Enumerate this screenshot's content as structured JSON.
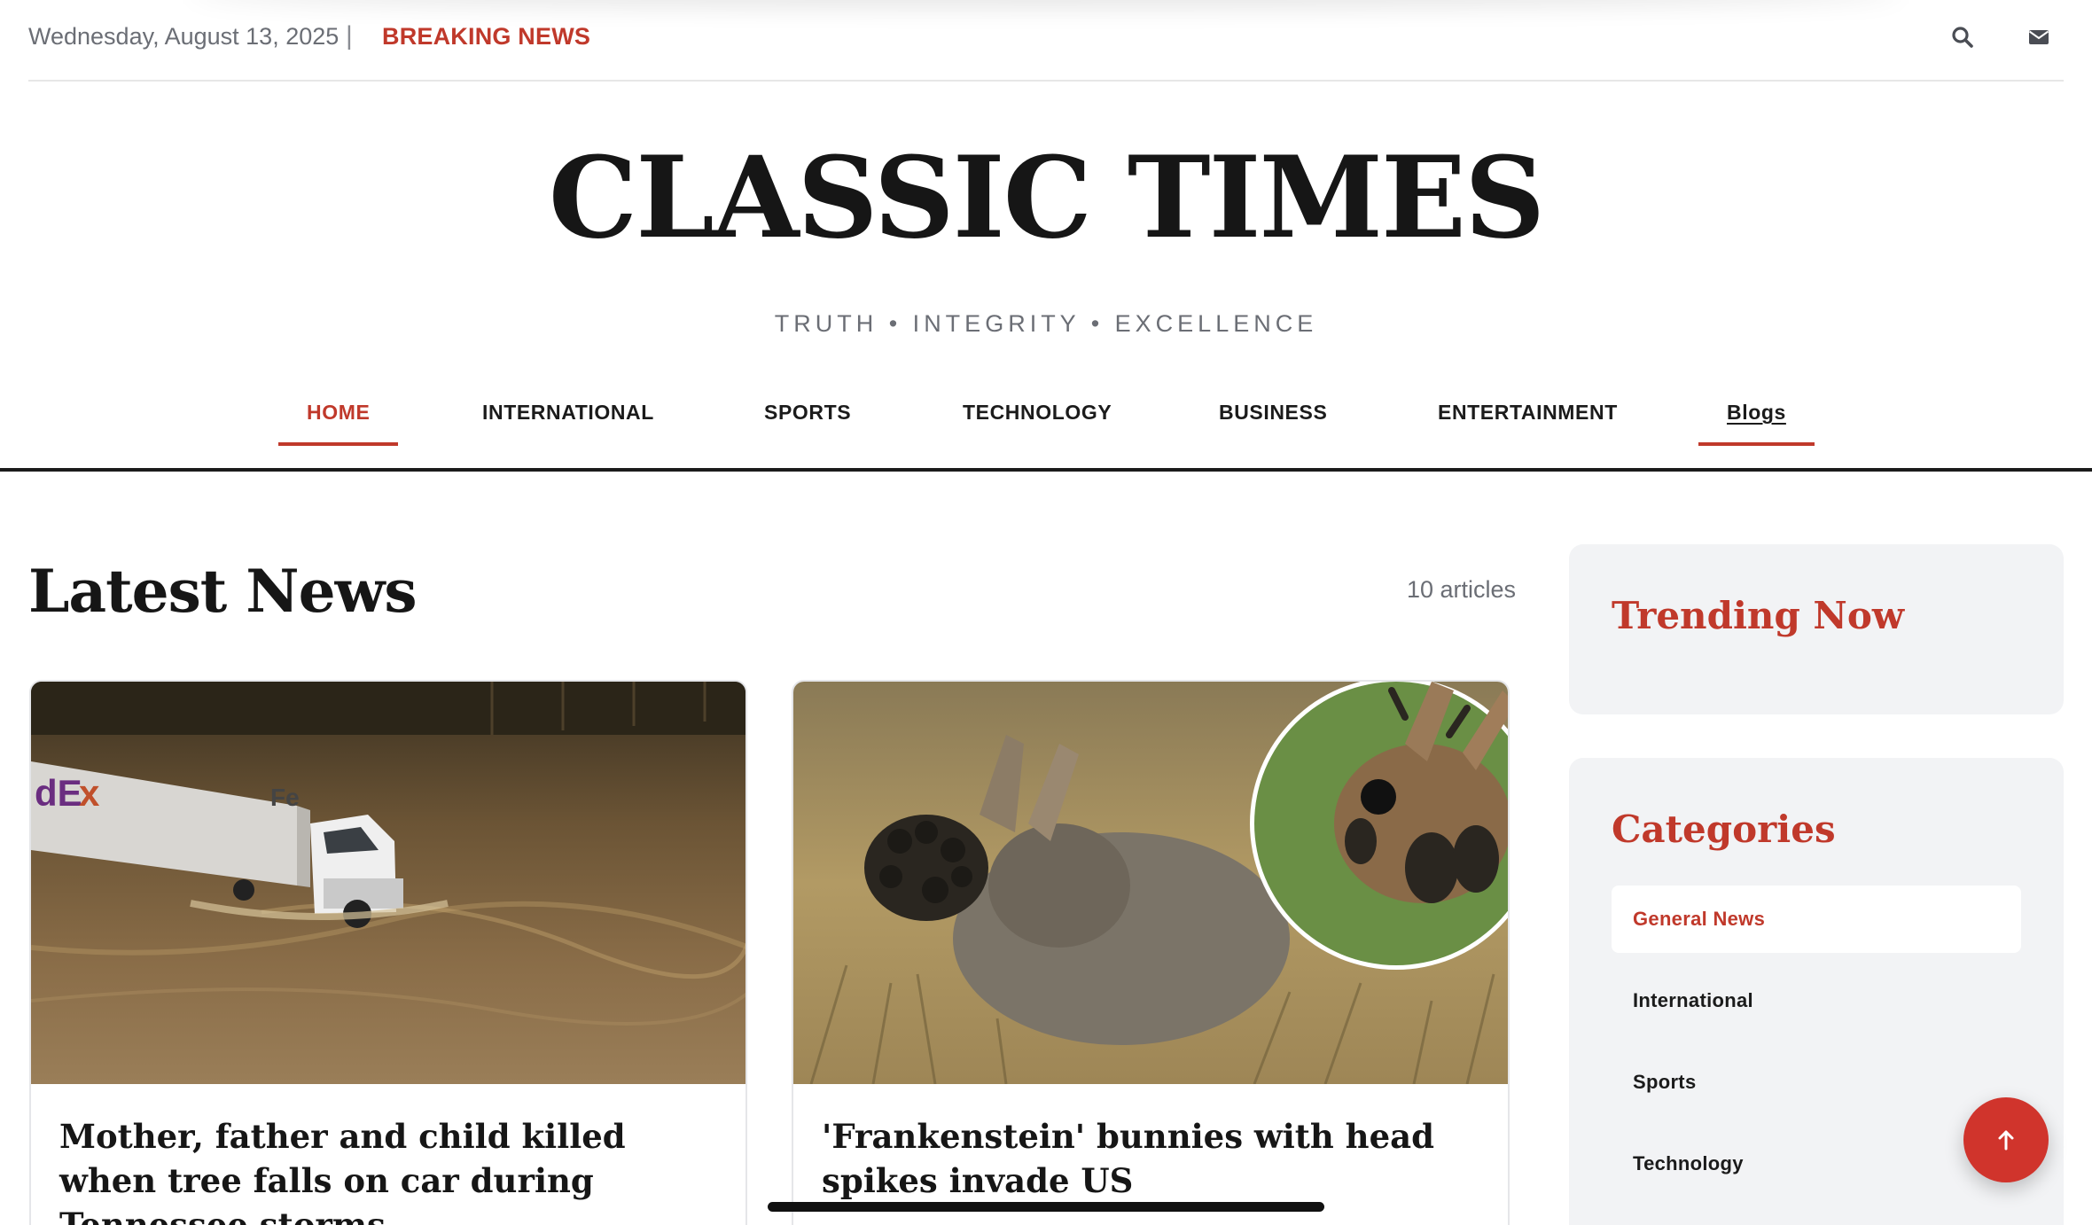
{
  "topbar": {
    "date": "Wednesday, August 13, 2025",
    "separator": "|",
    "breaking": "BREAKING NEWS",
    "icons": [
      "search-icon",
      "mail-icon"
    ]
  },
  "brand": {
    "name": "CLASSIC TIMES",
    "tagline": "TRUTH • INTEGRITY • EXCELLENCE"
  },
  "nav": {
    "items": [
      {
        "label": "HOME",
        "active": true
      },
      {
        "label": "INTERNATIONAL"
      },
      {
        "label": "SPORTS"
      },
      {
        "label": "TECHNOLOGY"
      },
      {
        "label": "BUSINESS"
      },
      {
        "label": "ENTERTAINMENT"
      },
      {
        "label": "Blogs"
      }
    ]
  },
  "latest": {
    "title": "Latest News",
    "count": "10 articles",
    "articles": [
      {
        "title": "Mother, father and child killed when tree falls on car during Tennessee storms",
        "image": "flooded-highway-truck-photo"
      },
      {
        "title": "'Frankenstein' bunnies with head spikes invade US",
        "image": "rabbit-with-growths-photo"
      }
    ]
  },
  "sidebar": {
    "trending_title": "Trending Now",
    "categories_title": "Categories",
    "categories": [
      {
        "label": "General News",
        "active": true
      },
      {
        "label": "International"
      },
      {
        "label": "Sports"
      },
      {
        "label": "Technology"
      }
    ]
  },
  "colors": {
    "accent": "#c0392b",
    "text": "#1b1b1b",
    "muted": "#6b6e75",
    "panel": "#f2f3f5"
  },
  "fab_icon": "arrow-up-icon"
}
